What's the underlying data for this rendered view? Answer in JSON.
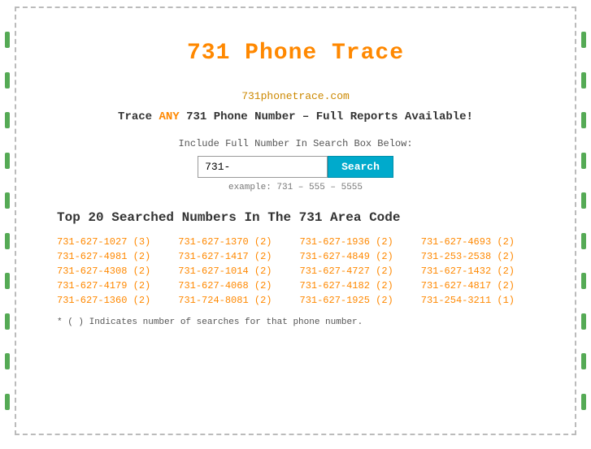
{
  "title": "731 Phone Trace",
  "site_url": "731phonetrace.com",
  "tagline_prefix": "Trace ",
  "tagline_any": "ANY",
  "tagline_suffix": " 731 Phone Number – Full Reports Available!",
  "search_label": "Include Full Number In Search Box Below:",
  "search_input_value": "731-",
  "search_button_label": "Search",
  "example_text": "example: 731 – 555 – 5555",
  "top_numbers_title": "Top 20 Searched Numbers In The 731 Area Code",
  "footnote": "* ( ) Indicates number of searches for that phone number.",
  "phone_numbers": [
    {
      "display": "731-627-1027 (3)",
      "href": "#"
    },
    {
      "display": "731-627-1370 (2)",
      "href": "#"
    },
    {
      "display": "731-627-1936 (2)",
      "href": "#"
    },
    {
      "display": "731-627-4693 (2)",
      "href": "#"
    },
    {
      "display": "731-627-4981 (2)",
      "href": "#"
    },
    {
      "display": "731-627-1417 (2)",
      "href": "#"
    },
    {
      "display": "731-627-4849 (2)",
      "href": "#"
    },
    {
      "display": "731-253-2538 (2)",
      "href": "#"
    },
    {
      "display": "731-627-4308 (2)",
      "href": "#"
    },
    {
      "display": "731-627-1014 (2)",
      "href": "#"
    },
    {
      "display": "731-627-4727 (2)",
      "href": "#"
    },
    {
      "display": "731-627-1432 (2)",
      "href": "#"
    },
    {
      "display": "731-627-4179 (2)",
      "href": "#"
    },
    {
      "display": "731-627-4068 (2)",
      "href": "#"
    },
    {
      "display": "731-627-4182 (2)",
      "href": "#"
    },
    {
      "display": "731-627-4817 (2)",
      "href": "#"
    },
    {
      "display": "731-627-1360 (2)",
      "href": "#"
    },
    {
      "display": "731-724-8081 (2)",
      "href": "#"
    },
    {
      "display": "731-627-1925 (2)",
      "href": "#"
    },
    {
      "display": "731-254-3211 (1)",
      "href": "#"
    }
  ],
  "colors": {
    "orange": "#ff8800",
    "teal": "#00aacc",
    "border": "#aaa",
    "green_marker": "#6a6"
  }
}
